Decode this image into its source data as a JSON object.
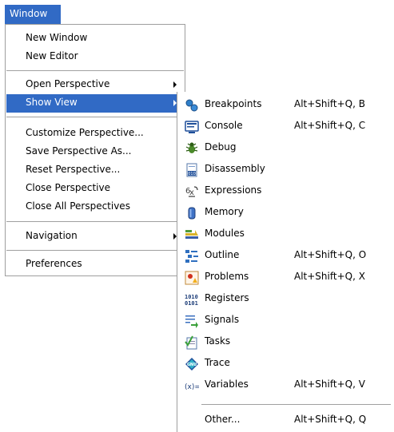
{
  "menubar": {
    "window_label": "Window"
  },
  "window_menu": {
    "new_window": "New Window",
    "new_editor": "New Editor",
    "open_perspective": "Open Perspective",
    "show_view": "Show View",
    "customize_perspective": "Customize Perspective...",
    "save_perspective_as": "Save Perspective As...",
    "reset_perspective": "Reset Perspective...",
    "close_perspective": "Close Perspective",
    "close_all_perspectives": "Close All Perspectives",
    "navigation": "Navigation",
    "preferences": "Preferences"
  },
  "show_view_submenu": {
    "items": [
      {
        "label": "Breakpoints",
        "shortcut": "Alt+Shift+Q, B",
        "icon": "breakpoints-icon"
      },
      {
        "label": "Console",
        "shortcut": "Alt+Shift+Q, C",
        "icon": "console-icon"
      },
      {
        "label": "Debug",
        "shortcut": "",
        "icon": "debug-icon"
      },
      {
        "label": "Disassembly",
        "shortcut": "",
        "icon": "disassembly-icon"
      },
      {
        "label": "Expressions",
        "shortcut": "",
        "icon": "expressions-icon"
      },
      {
        "label": "Memory",
        "shortcut": "",
        "icon": "memory-icon"
      },
      {
        "label": "Modules",
        "shortcut": "",
        "icon": "modules-icon"
      },
      {
        "label": "Outline",
        "shortcut": "Alt+Shift+Q, O",
        "icon": "outline-icon"
      },
      {
        "label": "Problems",
        "shortcut": "Alt+Shift+Q, X",
        "icon": "problems-icon"
      },
      {
        "label": "Registers",
        "shortcut": "",
        "icon": "registers-icon"
      },
      {
        "label": "Signals",
        "shortcut": "",
        "icon": "signals-icon"
      },
      {
        "label": "Tasks",
        "shortcut": "",
        "icon": "tasks-icon"
      },
      {
        "label": "Trace",
        "shortcut": "",
        "icon": "trace-icon"
      },
      {
        "label": "Variables",
        "shortcut": "Alt+Shift+Q, V",
        "icon": "variables-icon"
      }
    ],
    "other": {
      "label": "Other...",
      "shortcut": "Alt+Shift+Q, Q"
    }
  },
  "colors": {
    "highlight": "#316ac5",
    "separator": "#a0a0a0",
    "border": "#9e9e9e"
  }
}
